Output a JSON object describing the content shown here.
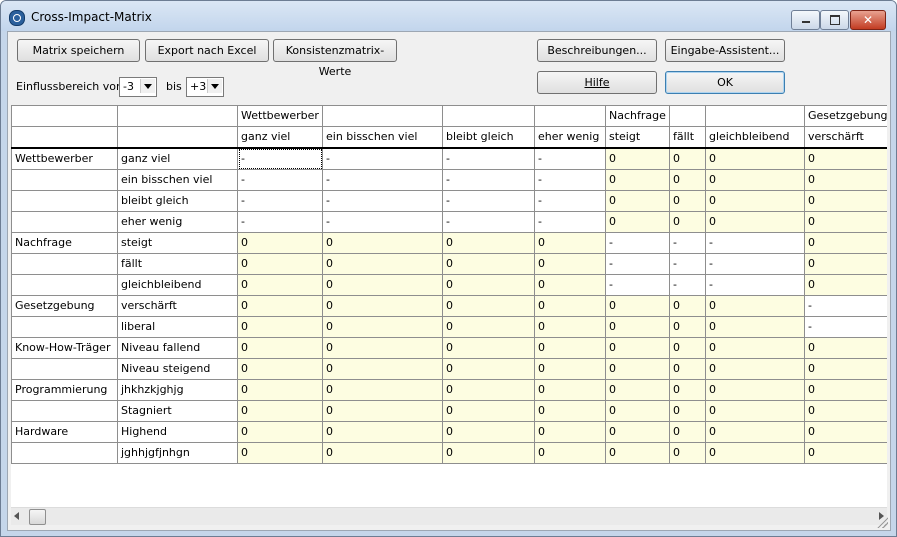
{
  "window": {
    "title": "Cross-Impact-Matrix"
  },
  "toolbar": {
    "save_matrix": "Matrix speichern",
    "export_excel": "Export nach Excel",
    "consistency_values": "Konsistenzmatrix-Werte",
    "descriptions": "Beschreibungen...",
    "input_assistant": "Eingabe-Assistent...",
    "help": "Hilfe",
    "ok": "OK"
  },
  "range": {
    "label_from": "Einflussbereich von",
    "from_value": "-3",
    "label_to": "bis",
    "to_value": "+3"
  },
  "grid": {
    "factor_headers": [
      "",
      "",
      "Wettbewerber",
      "",
      "",
      "",
      "Nachfrage",
      "",
      "",
      "Gesetzgebung"
    ],
    "option_headers": [
      "",
      "",
      "ganz viel",
      "ein bisschen viel",
      "bleibt gleich",
      "eher wenig",
      "steigt",
      "fällt",
      "gleichbleibend",
      "verschärft"
    ],
    "rows": [
      {
        "factor": "Wettbewerber",
        "option": "ganz viel",
        "cells": [
          "-",
          "-",
          "-",
          "-",
          "0",
          "0",
          "0",
          "0"
        ]
      },
      {
        "factor": "",
        "option": "ein bisschen viel",
        "cells": [
          "-",
          "-",
          "-",
          "-",
          "0",
          "0",
          "0",
          "0"
        ]
      },
      {
        "factor": "",
        "option": "bleibt gleich",
        "cells": [
          "-",
          "-",
          "-",
          "-",
          "0",
          "0",
          "0",
          "0"
        ]
      },
      {
        "factor": "",
        "option": "eher wenig",
        "cells": [
          "-",
          "-",
          "-",
          "-",
          "0",
          "0",
          "0",
          "0"
        ]
      },
      {
        "factor": "Nachfrage",
        "option": "steigt",
        "cells": [
          "0",
          "0",
          "0",
          "0",
          "-",
          "-",
          "-",
          "0"
        ]
      },
      {
        "factor": "",
        "option": "fällt",
        "cells": [
          "0",
          "0",
          "0",
          "0",
          "-",
          "-",
          "-",
          "0"
        ]
      },
      {
        "factor": "",
        "option": "gleichbleibend",
        "cells": [
          "0",
          "0",
          "0",
          "0",
          "-",
          "-",
          "-",
          "0"
        ]
      },
      {
        "factor": "Gesetzgebung",
        "option": "verschärft",
        "cells": [
          "0",
          "0",
          "0",
          "0",
          "0",
          "0",
          "0",
          "-"
        ]
      },
      {
        "factor": "",
        "option": "liberal",
        "cells": [
          "0",
          "0",
          "0",
          "0",
          "0",
          "0",
          "0",
          "-"
        ]
      },
      {
        "factor": "Know-How-Träger",
        "option": "Niveau fallend",
        "cells": [
          "0",
          "0",
          "0",
          "0",
          "0",
          "0",
          "0",
          "0"
        ]
      },
      {
        "factor": "",
        "option": "Niveau steigend",
        "cells": [
          "0",
          "0",
          "0",
          "0",
          "0",
          "0",
          "0",
          "0"
        ]
      },
      {
        "factor": "Programmierung",
        "option": "jhkhzkjghjg",
        "cells": [
          "0",
          "0",
          "0",
          "0",
          "0",
          "0",
          "0",
          "0"
        ]
      },
      {
        "factor": "",
        "option": "Stagniert",
        "cells": [
          "0",
          "0",
          "0",
          "0",
          "0",
          "0",
          "0",
          "0"
        ]
      },
      {
        "factor": "Hardware",
        "option": "Highend",
        "cells": [
          "0",
          "0",
          "0",
          "0",
          "0",
          "0",
          "0",
          "0"
        ]
      },
      {
        "factor": "",
        "option": "jghhjgfjnhgn",
        "cells": [
          "0",
          "0",
          "0",
          "0",
          "0",
          "0",
          "0",
          "0"
        ]
      }
    ]
  },
  "colors": {
    "editable_cell": "#fdfde1",
    "diagonal_cell": "#ffffff",
    "title_bar": "#c5d6ea"
  }
}
